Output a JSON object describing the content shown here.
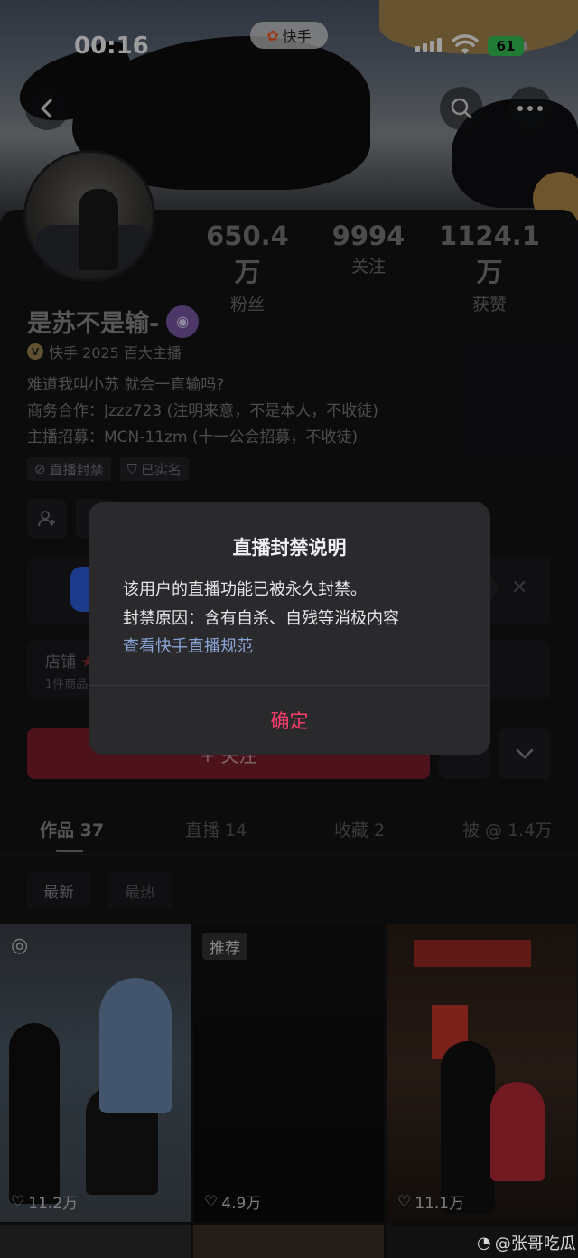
{
  "status_bar": {
    "time": "00:16",
    "app_name": "快手",
    "battery": "61"
  },
  "profile": {
    "stats": [
      {
        "value": "650.4万",
        "label": "粉丝"
      },
      {
        "value": "9994",
        "label": "关注"
      },
      {
        "value": "1124.1万",
        "label": "获赞"
      }
    ],
    "name": "是苏不是输-",
    "anchor_title": "快手 2025 百大主播",
    "bio": [
      "难道我叫小苏  就会一直输吗?",
      "商务合作：Jzzz723 (注明来意，不是本人，不收徒)",
      "主播招募：MCN-11zm (十一公会招募，不收徒)"
    ],
    "tags": [
      "直播封禁",
      "已实名"
    ]
  },
  "shop": {
    "title": "店铺",
    "subtitle": "1件商品"
  },
  "follow_button": "+ 关注",
  "tabs": [
    {
      "label": "作品 37"
    },
    {
      "label": "直播 14"
    },
    {
      "label": "收藏 2"
    },
    {
      "label": "被 @ 1.4万"
    }
  ],
  "sort": {
    "latest": "最新",
    "hottest": "最热"
  },
  "videos": [
    {
      "likes": "11.2万"
    },
    {
      "badge": "推荐",
      "likes": "4.9万"
    },
    {
      "likes": "11.1万"
    }
  ],
  "watermark": "@张哥吃瓜",
  "dialog": {
    "title": "直播封禁说明",
    "line1": "该用户的直播功能已被永久封禁。",
    "line2": "封禁原因：含有自杀、自残等消极内容",
    "link": "查看快手直播规范",
    "confirm": "确定"
  },
  "colors": {
    "accent": "#fe3c6a",
    "link": "#8aa4d6",
    "battery": "#34c759"
  }
}
